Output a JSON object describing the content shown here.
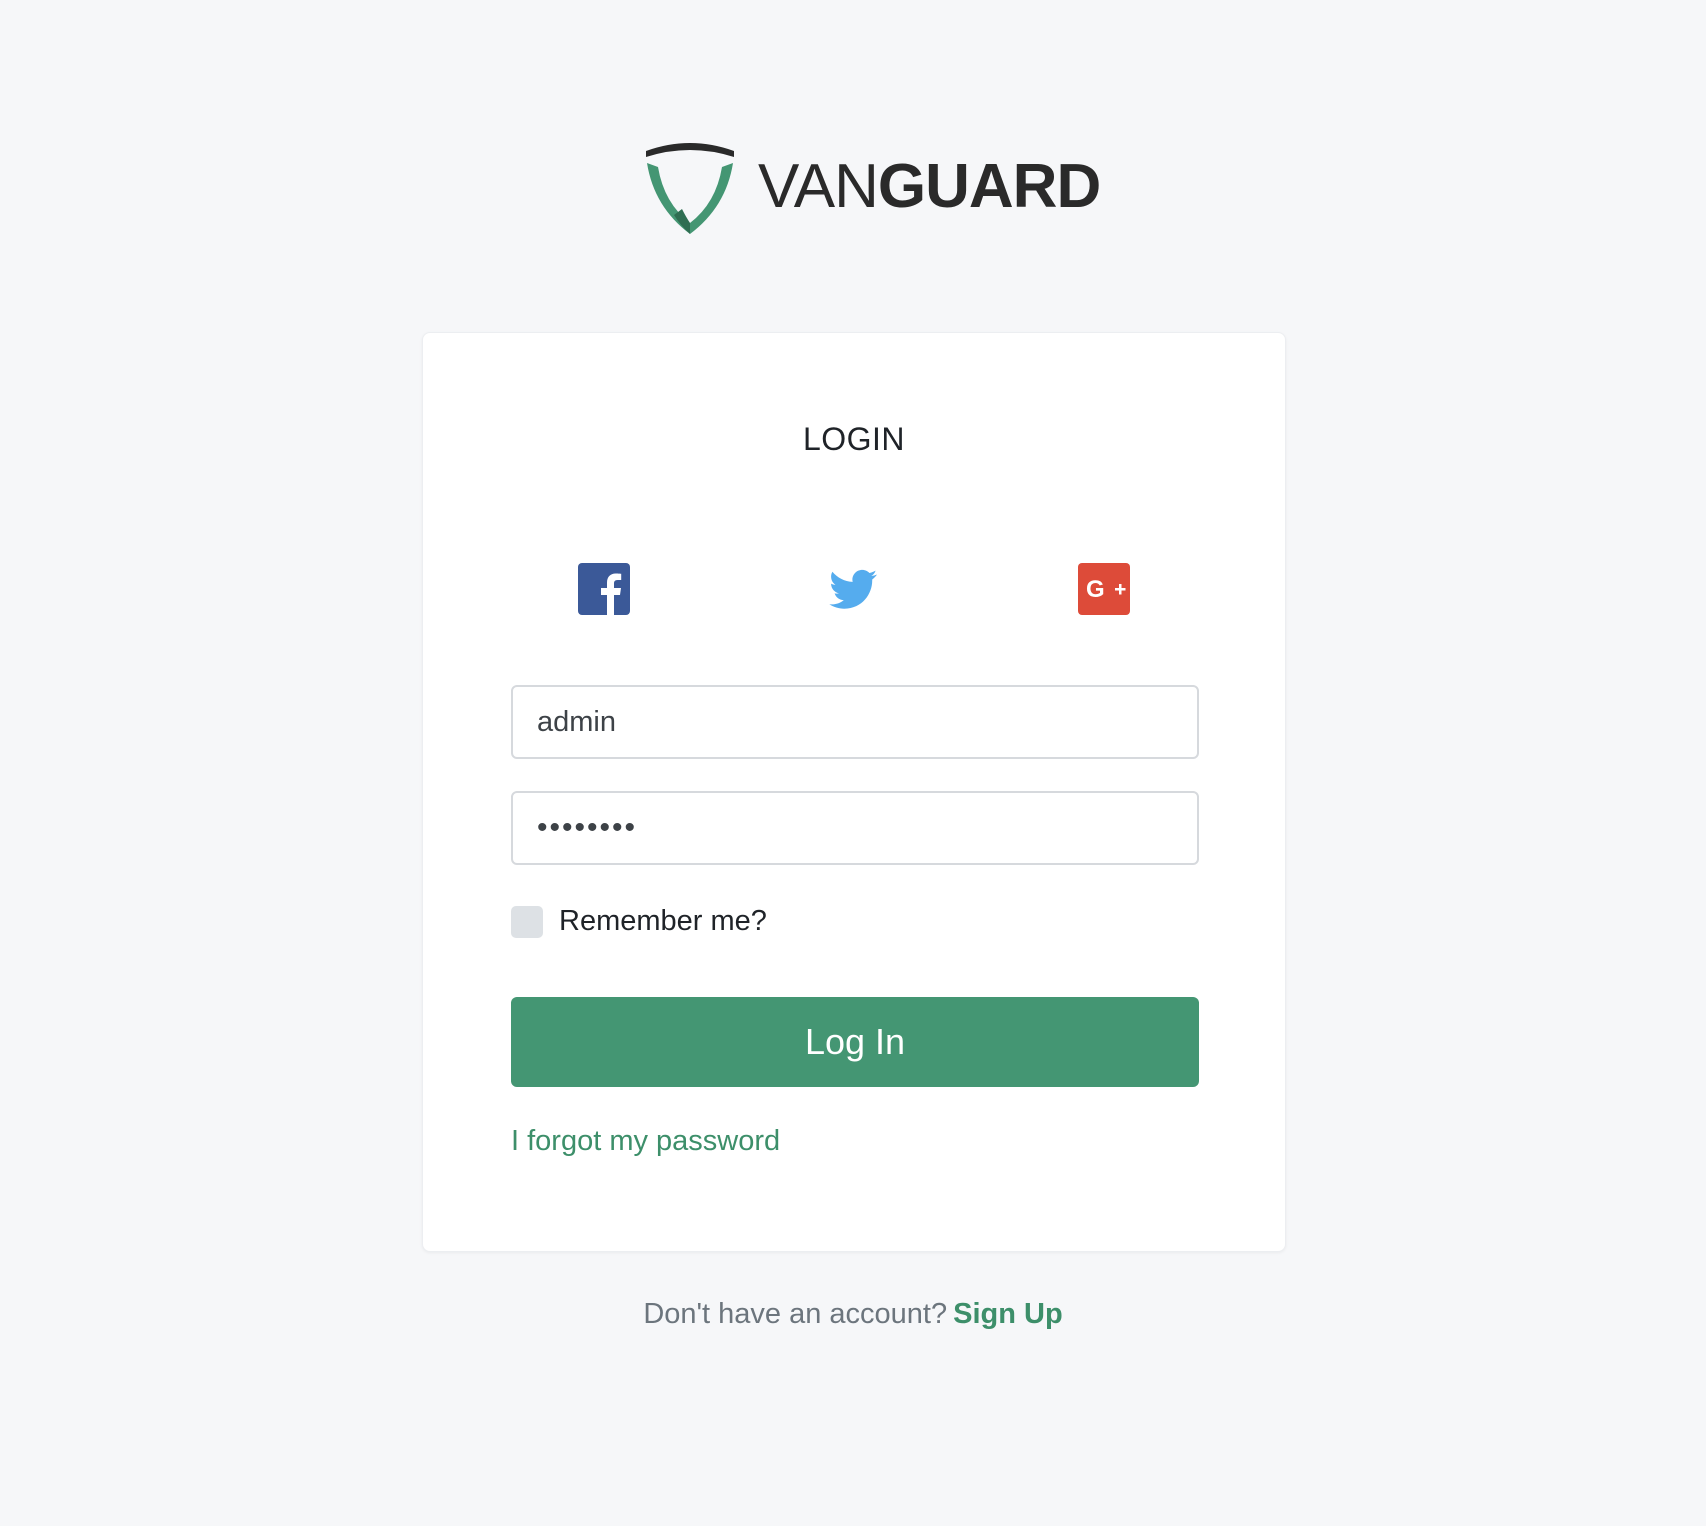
{
  "brand": {
    "name_light": "VAN",
    "name_bold": "GUARD",
    "shield_green": "#449673",
    "shield_dark": "#2a2a2a"
  },
  "login_card": {
    "title": "LOGIN",
    "social": [
      {
        "name": "facebook",
        "icon": "facebook-icon",
        "color": "#3b5998"
      },
      {
        "name": "twitter",
        "icon": "twitter-icon",
        "color": "#55acee"
      },
      {
        "name": "google-plus",
        "icon": "google-plus-icon",
        "color": "#dd4b39"
      }
    ],
    "username": {
      "value": "admin"
    },
    "password": {
      "value": "••••••••"
    },
    "remember_label": "Remember me?",
    "login_button": "Log In",
    "forgot_link": "I forgot my password"
  },
  "footer": {
    "prompt": "Don't have an account?",
    "signup_link": "Sign Up"
  },
  "colors": {
    "background": "#f6f7f9",
    "accent": "#449673",
    "link": "#3d8f6a"
  }
}
